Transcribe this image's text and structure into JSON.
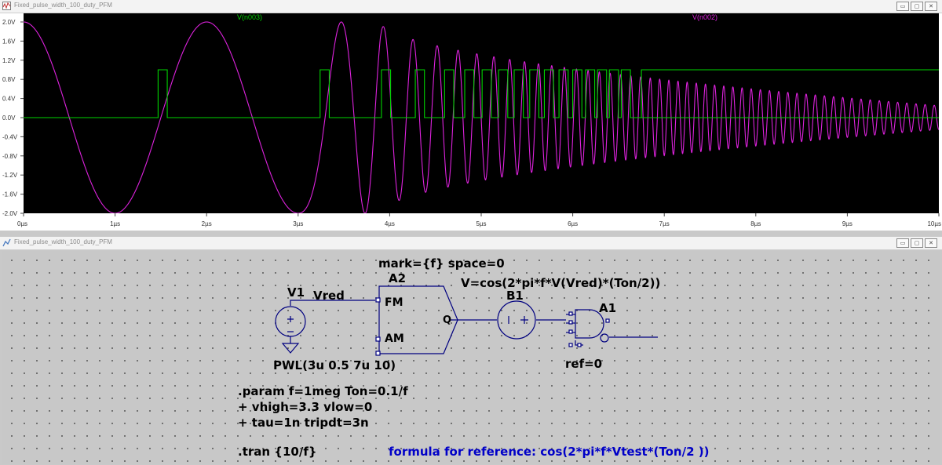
{
  "colors": {
    "trace_v_n003": "#00d400",
    "trace_v_n002": "#dd22dd",
    "plot_background": "#000000",
    "wire": "#000080",
    "comment_text": "#0000c8"
  },
  "waveform_window": {
    "title": "Fixed_pulse_width_100_duty_PFM",
    "controls": {
      "minimize": "▭",
      "restore": "▢",
      "close": "✕"
    },
    "traces": [
      {
        "name": "V(n003)",
        "color": "#00d400"
      },
      {
        "name": "V(n002)",
        "color": "#dd22dd"
      }
    ]
  },
  "chart_data": {
    "type": "line",
    "title": "",
    "xlabel": "",
    "ylabel": "",
    "x_unit": "µs",
    "xlim": [
      0,
      10
    ],
    "ylim": [
      -2.0,
      2.0
    ],
    "x_ticks": [
      "0µs",
      "1µs",
      "2µs",
      "3µs",
      "4µs",
      "5µs",
      "6µs",
      "7µs",
      "8µs",
      "9µs",
      "10µs"
    ],
    "y_ticks": [
      "2.0V",
      "1.6V",
      "1.2V",
      "0.8V",
      "0.4V",
      "0.0V",
      "-0.4V",
      "-0.8V",
      "-1.2V",
      "-1.6V",
      "-2.0V"
    ],
    "grid": false,
    "series": [
      {
        "name": "V(n003)",
        "description_of_shape": "logic output; 0 V baseline with 1 V pulses, constant 1 V from 6.75µs on",
        "baseline": 0,
        "high": 1,
        "pulses_us": [
          [
            1.47,
            1.57
          ],
          [
            3.24,
            3.34
          ],
          [
            3.91,
            4.01
          ],
          [
            4.28,
            4.38
          ],
          [
            4.6,
            4.7
          ],
          [
            4.82,
            4.92
          ],
          [
            5.01,
            5.11
          ],
          [
            5.19,
            5.29
          ],
          [
            5.36,
            5.46
          ],
          [
            5.53,
            5.63
          ],
          [
            5.69,
            5.79
          ],
          [
            5.85,
            5.95
          ],
          [
            6.0,
            6.1
          ],
          [
            6.14,
            6.24
          ],
          [
            6.27,
            6.37
          ],
          [
            6.4,
            6.5
          ],
          [
            6.53,
            6.63
          ]
        ],
        "constant_high_from_us": 6.75
      },
      {
        "name": "V(n002)",
        "description_of_shape": "cosine of an accumulating phase; frequency ramps linearly from 0.5 MHz to 10 MHz between 3µs and 7µs; amplitude 2 V before 3µs, decays to about 0.25 V late in the window",
        "formula": "V = A(t) * cos(2*pi*phi(t))",
        "frequency_MHz": {
          "before_3us": 0.5,
          "ramp_start_us": 3,
          "ramp_end_us": 7,
          "after_7us": 10
        },
        "amplitude_V": {
          "start": 2.0,
          "decay_start_us": 3.9,
          "end": 0.25
        }
      }
    ]
  },
  "schematic_window": {
    "title": "Fixed_pulse_width_100_duty_PFM",
    "controls": {
      "minimize": "▭",
      "restore": "▢",
      "close": "✕"
    },
    "components": {
      "v1": {
        "name": "V1",
        "value": "PWL(3u 0.5 7u 10)"
      },
      "net_label": "Vred",
      "a2": {
        "name": "A2",
        "params": "mark={f} space=0",
        "pins": {
          "fm": "FM",
          "am": "AM",
          "q": "Q"
        }
      },
      "b1": {
        "name": "B1",
        "expression": "V=cos(2*pi*f*V(Vred)*(Ton/2))"
      },
      "a1": {
        "name": "A1",
        "params": "ref=0"
      }
    },
    "directives": [
      ".param f=1meg Ton=0.1/f",
      "+ vhigh=3.3 vlow=0",
      "+ tau=1n tripdt=3n"
    ],
    "tran": ".tran {10/f}",
    "comment": "formula for reference: cos(2*pi*f*Vtest*(Ton/2 ))"
  }
}
